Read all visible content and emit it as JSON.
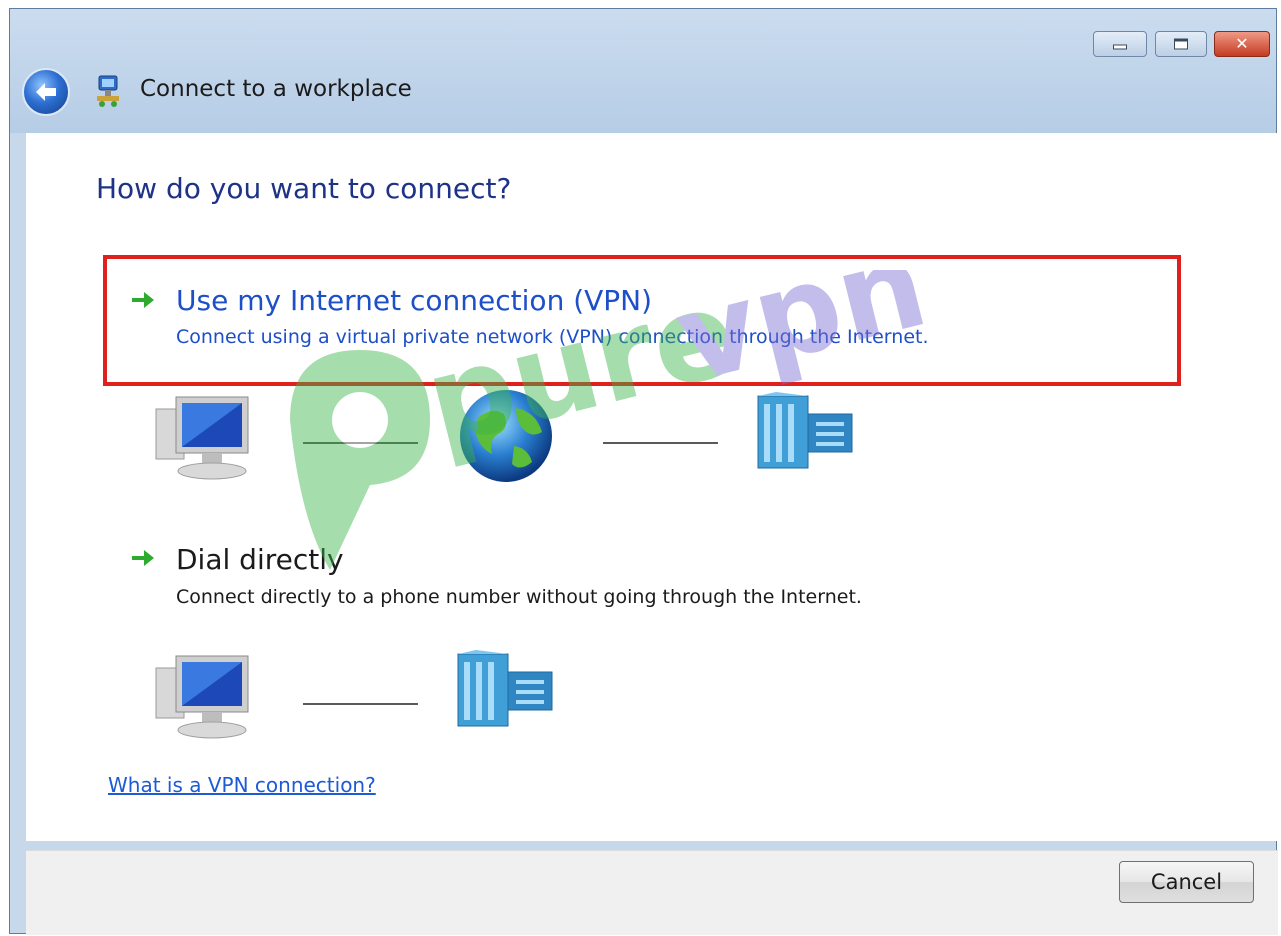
{
  "window": {
    "title": "Connect to a workplace"
  },
  "titlebar_buttons": {
    "minimize_icon": "minimize-icon",
    "maximize_icon": "maximize-icon",
    "close_icon": "close-icon",
    "close_glyph": "✕"
  },
  "main": {
    "heading": "How do you want to connect?",
    "options": [
      {
        "title": "Use my Internet connection (VPN)",
        "description": "Connect using a virtual private network (VPN) connection through the Internet.",
        "highlighted": true
      },
      {
        "title": "Dial directly",
        "description": "Connect directly to a phone number without going through the Internet.",
        "highlighted": false
      }
    ],
    "help_link": "What is a VPN connection?"
  },
  "footer": {
    "cancel_label": "Cancel"
  },
  "watermark": {
    "text": "purevpn"
  },
  "colors": {
    "highlight_border": "#e0201c",
    "link_blue": "#1d4fc8",
    "heading_blue": "#1e3287",
    "arrow_green": "#2eab2e",
    "watermark_green": "#3cb44b",
    "watermark_purple": "#7b6fd6"
  }
}
